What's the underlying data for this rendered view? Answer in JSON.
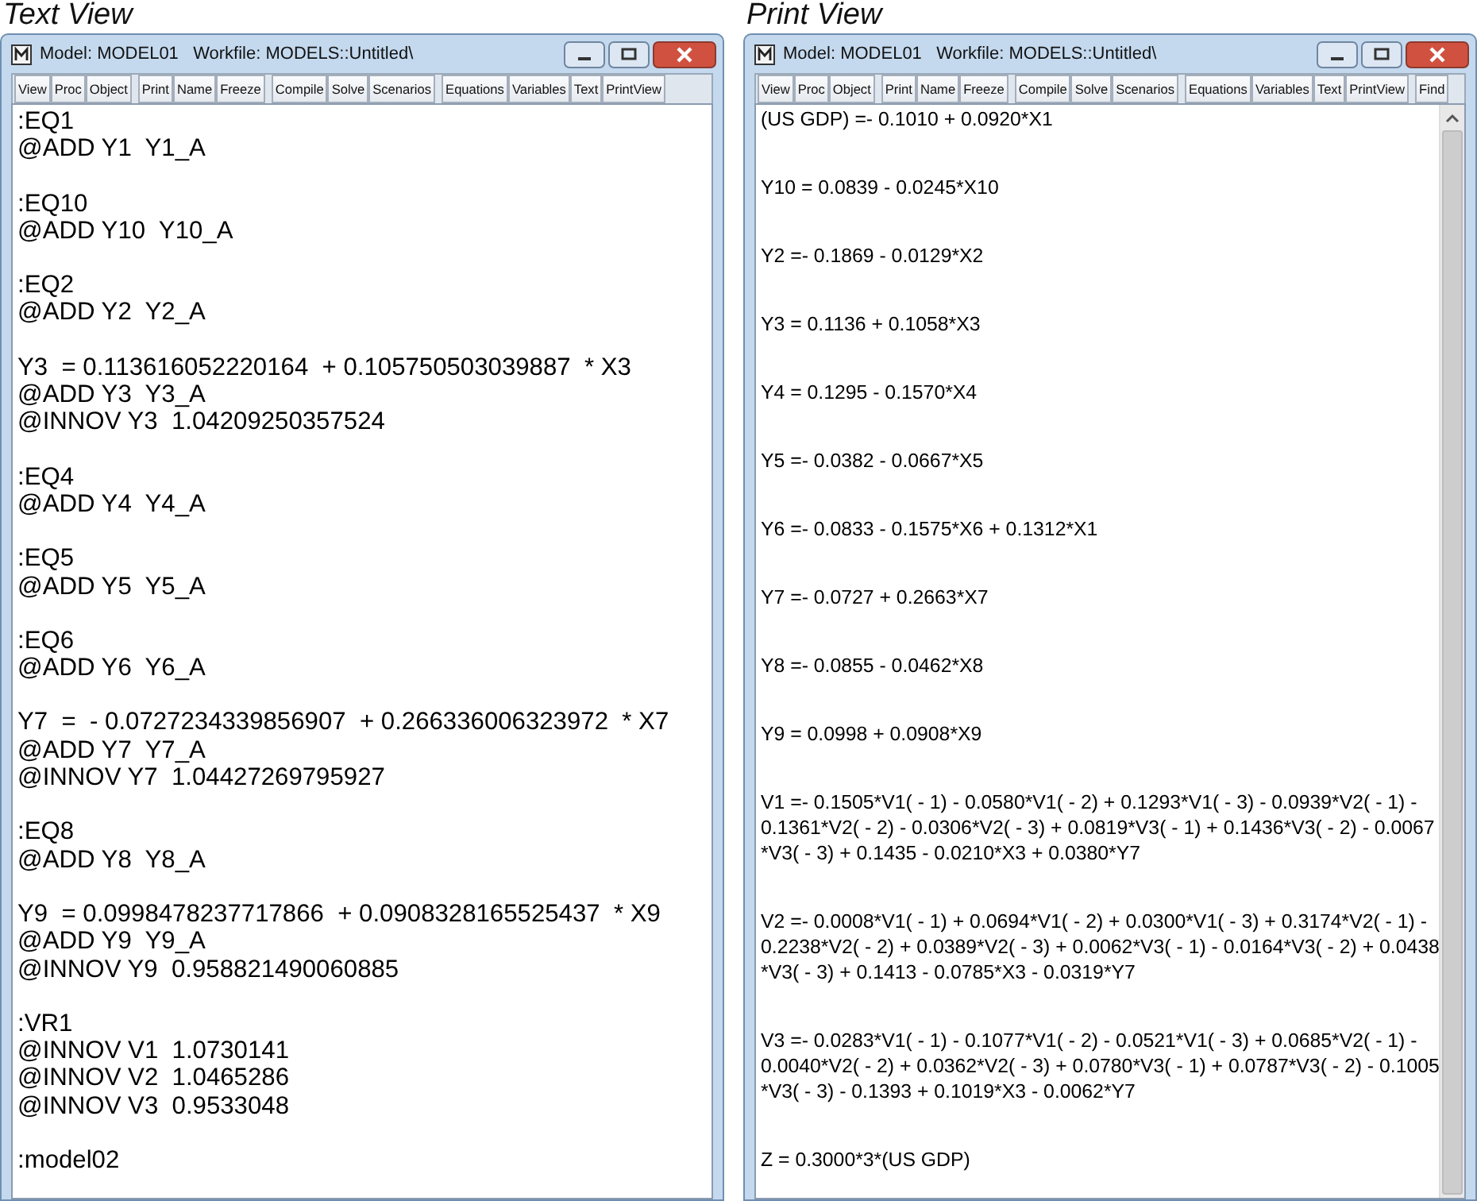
{
  "views": [
    {
      "caption": "Text View",
      "kind": "text",
      "window": {
        "title": "Model: MODEL01   Workfile: MODELS::Untitled\\",
        "toolbar": [
          [
            "View",
            "Proc",
            "Object"
          ],
          [
            "Print",
            "Name",
            "Freeze"
          ],
          [
            "Compile",
            "Solve",
            "Scenarios"
          ],
          [
            "Equations",
            "Variables",
            "Text",
            "PrintView"
          ]
        ]
      },
      "blocks": [
        [
          ":EQ1",
          "@ADD Y1  Y1_A"
        ],
        [
          ":EQ10",
          "@ADD Y10  Y10_A"
        ],
        [
          ":EQ2",
          "@ADD Y2  Y2_A"
        ],
        [
          "Y3  = 0.113616052220164  + 0.105750503039887  * X3",
          "@ADD Y3  Y3_A",
          "@INNOV Y3  1.04209250357524"
        ],
        [
          ":EQ4",
          "@ADD Y4  Y4_A"
        ],
        [
          ":EQ5",
          "@ADD Y5  Y5_A"
        ],
        [
          ":EQ6",
          "@ADD Y6  Y6_A"
        ],
        [
          "Y7  =  - 0.0727234339856907  + 0.266336006323972  * X7",
          "@ADD Y7  Y7_A",
          "@INNOV Y7  1.04427269795927"
        ],
        [
          ":EQ8",
          "@ADD Y8  Y8_A"
        ],
        [
          "Y9  = 0.0998478237717866  + 0.0908328165525437  * X9",
          "@ADD Y9  Y9_A",
          "@INNOV Y9  0.958821490060885"
        ],
        [
          ":VR1",
          "@INNOV V1  1.0730141",
          "@INNOV V2  1.0465286",
          "@INNOV V3  0.9533048"
        ],
        [
          ":model02"
        ]
      ]
    },
    {
      "caption": "Print View",
      "kind": "print",
      "window": {
        "title": "Model: MODEL01   Workfile: MODELS::Untitled\\",
        "toolbar": [
          [
            "View",
            "Proc",
            "Object"
          ],
          [
            "Print",
            "Name",
            "Freeze"
          ],
          [
            "Compile",
            "Solve",
            "Scenarios"
          ],
          [
            "Equations",
            "Variables",
            "Text",
            "PrintView"
          ],
          [
            "Find"
          ]
        ]
      },
      "blocks": [
        [
          "(US GDP) =- 0.1010 + 0.0920*X1"
        ],
        [
          "Y10 = 0.0839 - 0.0245*X10"
        ],
        [
          "Y2 =- 0.1869 - 0.0129*X2"
        ],
        [
          "Y3 = 0.1136 + 0.1058*X3"
        ],
        [
          "Y4 = 0.1295 - 0.1570*X4"
        ],
        [
          "Y5 =- 0.0382 - 0.0667*X5"
        ],
        [
          "Y6 =- 0.0833 - 0.1575*X6 + 0.1312*X1"
        ],
        [
          "Y7 =- 0.0727 + 0.2663*X7"
        ],
        [
          "Y8 =- 0.0855 - 0.0462*X8"
        ],
        [
          "Y9 = 0.0998 + 0.0908*X9"
        ],
        [
          "V1 =- 0.1505*V1( - 1) - 0.0580*V1( - 2) + 0.1293*V1( - 3) - 0.0939*V2( - 1) -",
          "0.1361*V2( - 2) - 0.0306*V2( - 3) + 0.0819*V3( - 1) + 0.1436*V3( - 2) - 0.0067",
          "*V3( - 3) + 0.1435 - 0.0210*X3 + 0.0380*Y7"
        ],
        [
          "V2 =- 0.0008*V1( - 1) + 0.0694*V1( - 2) + 0.0300*V1( - 3) + 0.3174*V2( - 1) -",
          "0.2238*V2( - 2) + 0.0389*V2( - 3) + 0.0062*V3( - 1) - 0.0164*V3( - 2) + 0.0438",
          "*V3( - 3) + 0.1413 - 0.0785*X3 - 0.0319*Y7"
        ],
        [
          "V3 =- 0.0283*V1( - 1) - 0.1077*V1( - 2) - 0.0521*V1( - 3) + 0.0685*V2( - 1) -",
          "0.0040*V2( - 2) + 0.0362*V2( - 3) + 0.0780*V3( - 1) + 0.0787*V3( - 2) - 0.1005",
          "*V3( - 3) - 0.1393 + 0.1019*X3 - 0.0062*Y7"
        ],
        [
          "Z = 0.3000*3*(US GDP)"
        ]
      ]
    }
  ]
}
